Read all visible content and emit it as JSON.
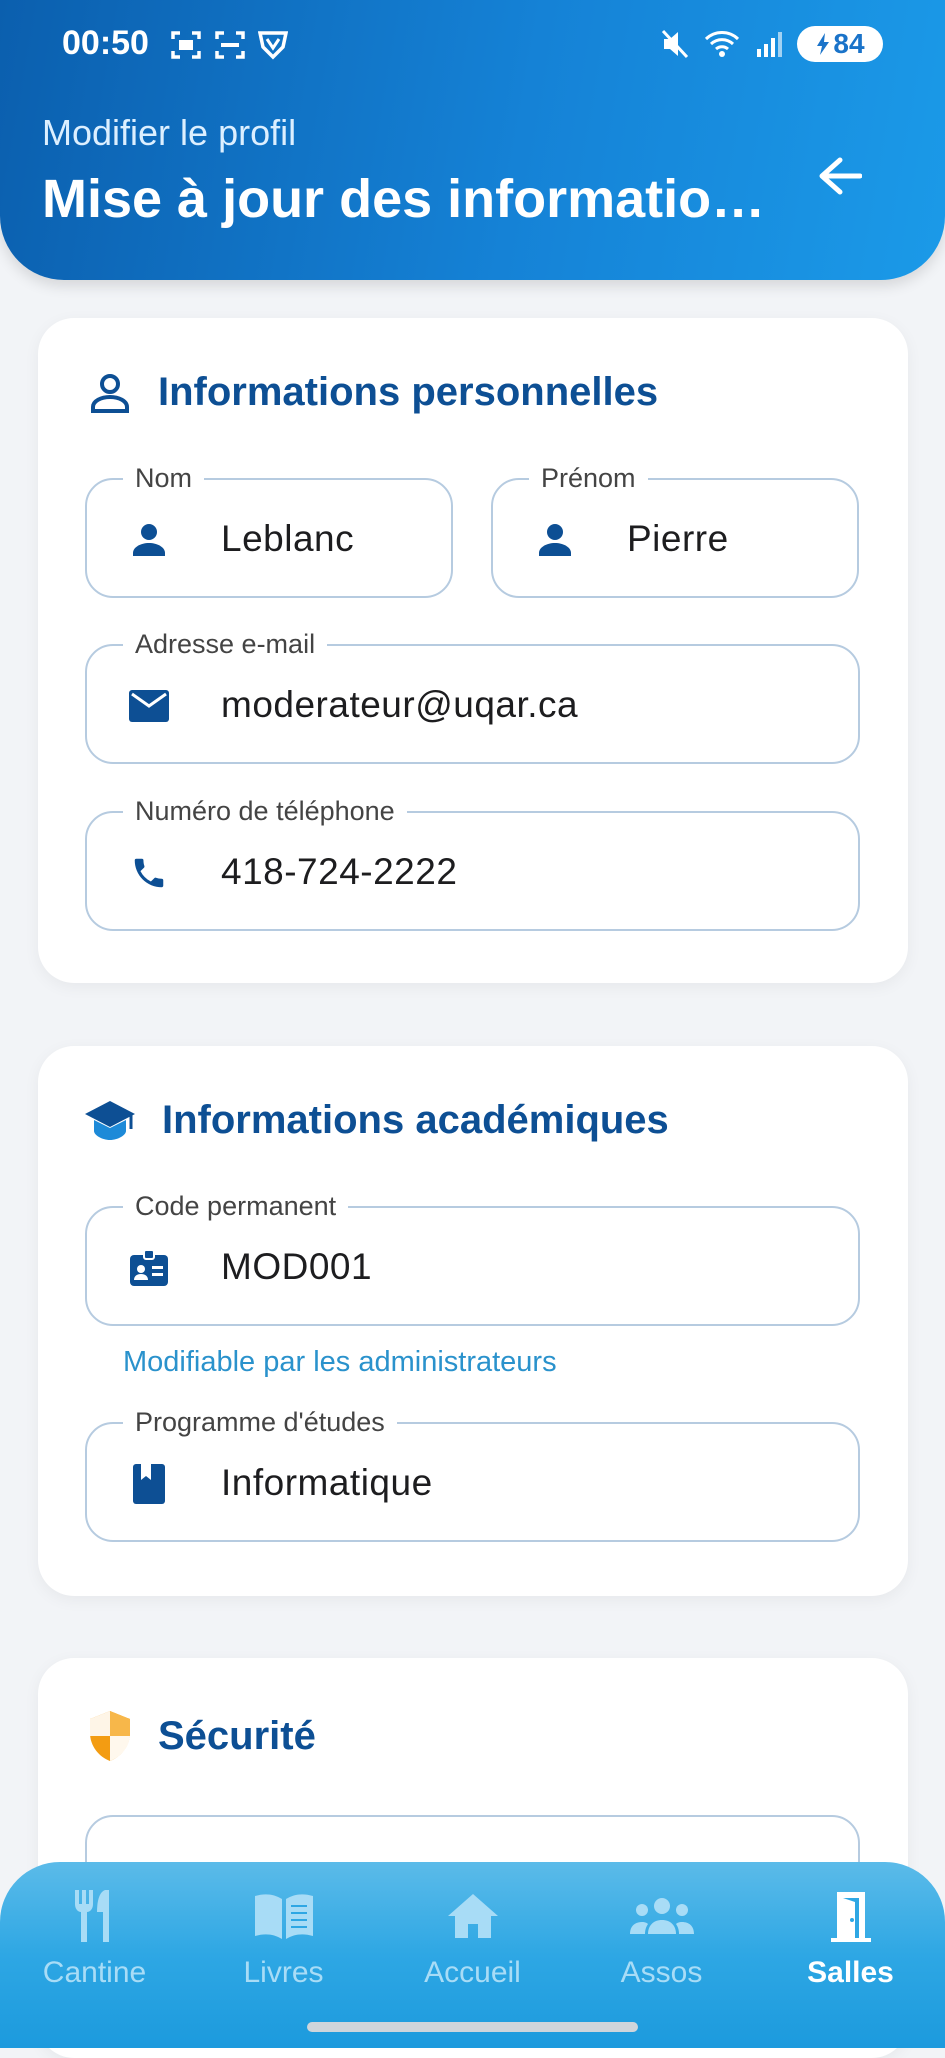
{
  "status_bar": {
    "time": "00:50",
    "battery": "84",
    "icons": [
      "screenshot-icon",
      "scan-icon",
      "vpn-shield-icon",
      "mute-icon",
      "wifi-icon",
      "signal-icon",
      "charging-icon"
    ]
  },
  "header": {
    "subtitle": "Modifier le profil",
    "title": "Mise à jour des informatio…",
    "back_icon": "arrow-back-icon"
  },
  "personal": {
    "title": "Informations personnelles",
    "icon": "person-outline-icon",
    "fields": {
      "nom": {
        "label": "Nom",
        "value": "Leblanc",
        "icon": "person-icon"
      },
      "prenom": {
        "label": "Prénom",
        "value": "Pierre",
        "icon": "person-icon"
      },
      "email": {
        "label": "Adresse e-mail",
        "value": "moderateur@uqar.ca",
        "icon": "mail-icon"
      },
      "phone": {
        "label": "Numéro de téléphone",
        "value": "418-724-2222",
        "icon": "phone-icon"
      }
    }
  },
  "academic": {
    "title": "Informations académiques",
    "icon": "graduation-cap-icon",
    "fields": {
      "code": {
        "label": "Code permanent",
        "value": "MOD001",
        "icon": "id-badge-icon",
        "helper": "Modifiable par les administrateurs"
      },
      "program": {
        "label": "Programme d'études",
        "value": "Informatique",
        "icon": "book-icon"
      }
    }
  },
  "security": {
    "title": "Sécurité",
    "icon": "shield-icon"
  },
  "bottom_nav": {
    "items": [
      {
        "label": "Cantine",
        "icon": "utensils-icon",
        "active": false
      },
      {
        "label": "Livres",
        "icon": "open-book-icon",
        "active": false
      },
      {
        "label": "Accueil",
        "icon": "home-icon",
        "active": false
      },
      {
        "label": "Assos",
        "icon": "group-icon",
        "active": false
      },
      {
        "label": "Salles",
        "icon": "door-icon",
        "active": true
      }
    ]
  },
  "colors": {
    "header_start": "#0b5fae",
    "header_end": "#1b9ae8",
    "title_blue": "#0d4f94",
    "icon_blue": "#0d4f94",
    "helper_blue": "#2a92cc",
    "shield_orange": "#f39c12",
    "nav_blue": "#2ea7e4"
  }
}
